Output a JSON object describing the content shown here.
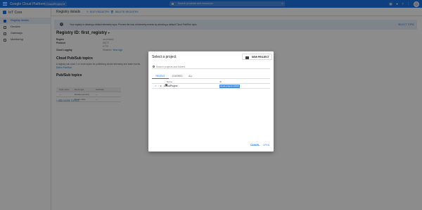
{
  "topbar": {
    "brand": "Google Cloud Platform",
    "project": "CloudProject ▾",
    "search_placeholder": "Search products and resources",
    "icons": [
      "apps-icon",
      "notifications-icon",
      "help-icon",
      "more-vert-icon"
    ]
  },
  "sidebar": {
    "title": "IoT Core",
    "items": [
      {
        "label": "Registry details",
        "active": true
      },
      {
        "label": "Devices",
        "active": false
      },
      {
        "label": "Gateways",
        "active": false
      },
      {
        "label": "Monitoring",
        "active": false
      }
    ]
  },
  "content": {
    "title": "Registry details",
    "edit_label": "EDIT REGISTRY",
    "delete_label": "DELETE REGISTRY",
    "banner_text": "Your registry is missing a default telemetry topic. Prevent the loss of telemetry events by selecting a default Cloud Pub/Sub topic.",
    "banner_link": "SELECT TOPIC",
    "registry_title": "Registry ID:  first_registry",
    "registry_dropdown": "▾",
    "details": [
      {
        "key": "Region",
        "value": "us-central1"
      },
      {
        "key": "Protocol",
        "value": "MQTT"
      },
      {
        "key": "",
        "value": "HTTP"
      },
      {
        "key": "Cloud Logging",
        "value": "Disabled",
        "link": "View logs"
      }
    ],
    "pubsub_title": "Cloud Pub/Sub topics",
    "pubsub_text": "A registry can have 1 or more topics for publishing device telemetry and state events.",
    "pubsub_link": "Edit in Pub/Sub",
    "pubsub_table_title": "Pub/Sub topics",
    "pubsub_columns": [
      "Topic name",
      "Event type",
      "Subfolder"
    ],
    "pubsub_rows": [
      {
        "name": "—",
        "event": "Default telemetry",
        "sub": "—"
      },
      {
        "name": "—",
        "event": "Device state",
        "sub": "—"
      }
    ],
    "add_more": "+ ADD MORE TOPICS"
  },
  "dialog": {
    "title": "Select a project",
    "new_project": "NEW PROJECT",
    "search_placeholder": "Search projects and folders",
    "tabs": [
      {
        "label": "RECENT",
        "active": true
      },
      {
        "label": "STARRED",
        "active": false
      },
      {
        "label": "ALL",
        "active": false
      }
    ],
    "columns": {
      "name": "Name",
      "id": "ID"
    },
    "rows": [
      {
        "name": "CloudProject",
        "help": "?",
        "id": "cloud-project-12345",
        "selected": true
      }
    ],
    "cancel": "CANCEL",
    "open": "OPEN"
  }
}
